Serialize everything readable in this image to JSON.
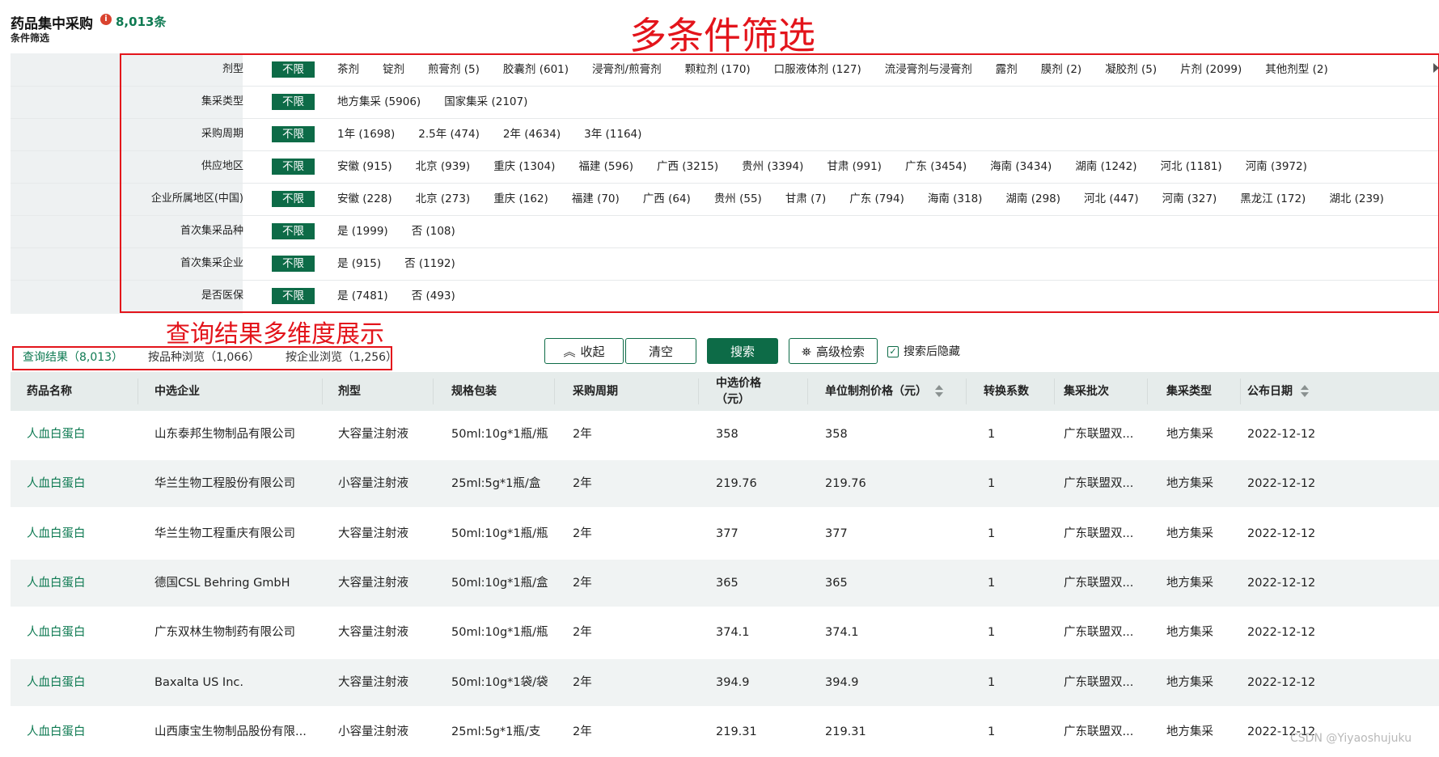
{
  "header": {
    "title": "药品集中采购",
    "info_icon": "info-icon",
    "info_glyph": "i",
    "count": "8,013条",
    "subtitle": "条件筛选"
  },
  "annotations": {
    "filter_note": "多条件筛选",
    "results_note": "查询结果多维度展示"
  },
  "filters": [
    {
      "label": "剂型",
      "options": [
        "不限",
        "茶剂",
        "锭剂",
        "煎膏剂 (5)",
        "胶囊剂 (601)",
        "浸膏剂/煎膏剂",
        "颗粒剂 (170)",
        "口服液体剂 (127)",
        "流浸膏剂与浸膏剂",
        "露剂",
        "膜剂 (2)",
        "凝胶剂 (5)",
        "片剂 (2099)",
        "其他剂型 (2)"
      ]
    },
    {
      "label": "集采类型",
      "options": [
        "不限",
        "地方集采 (5906)",
        "国家集采 (2107)"
      ]
    },
    {
      "label": "采购周期",
      "options": [
        "不限",
        "1年 (1698)",
        "2.5年 (474)",
        "2年 (4634)",
        "3年 (1164)"
      ]
    },
    {
      "label": "供应地区",
      "options": [
        "不限",
        "安徽 (915)",
        "北京 (939)",
        "重庆 (1304)",
        "福建 (596)",
        "广西 (3215)",
        "贵州 (3394)",
        "甘肃 (991)",
        "广东 (3454)",
        "海南 (3434)",
        "湖南 (1242)",
        "河北 (1181)",
        "河南 (3972)"
      ]
    },
    {
      "label": "企业所属地区(中国)",
      "options": [
        "不限",
        "安徽 (228)",
        "北京 (273)",
        "重庆 (162)",
        "福建 (70)",
        "广西 (64)",
        "贵州 (55)",
        "甘肃 (7)",
        "广东 (794)",
        "海南 (318)",
        "湖南 (298)",
        "河北 (447)",
        "河南 (327)",
        "黑龙江 (172)",
        "湖北 (239)"
      ]
    },
    {
      "label": "首次集采品种",
      "options": [
        "不限",
        "是 (1999)",
        "否 (108)"
      ]
    },
    {
      "label": "首次集采企业",
      "options": [
        "不限",
        "是 (915)",
        "否 (1192)"
      ]
    },
    {
      "label": "是否医保",
      "options": [
        "不限",
        "是 (7481)",
        "否 (493)"
      ]
    }
  ],
  "tabs": [
    "查询结果（8,013）",
    "按品种浏览（1,066）",
    "按企业浏览（1,256）"
  ],
  "buttons": {
    "collapse": "收起",
    "collapse_icon": "chevron-up-icon",
    "collapse_glyph": "︽",
    "clear": "清空",
    "search": "搜索",
    "advanced": "高级检索",
    "advanced_icon": "advanced-search-icon",
    "advanced_glyph": "⛯",
    "hide_after_search": "搜索后隐藏",
    "hide_after_search_checked": true,
    "check_glyph": "✓"
  },
  "table": {
    "headers": [
      "药品名称",
      "中选企业",
      "剂型",
      "规格包装",
      "采购周期",
      "中选价格（元）",
      "单位制剂价格（元）",
      "转换系数",
      "集采批次",
      "集采类型",
      "公布日期"
    ],
    "price_header_line1": "中选价格",
    "price_header_line2": "（元）",
    "rows": [
      [
        "人血白蛋白",
        "山东泰邦生物制品有限公司",
        "大容量注射液",
        "50ml:10g*1瓶/瓶",
        "2年",
        "358",
        "358",
        "1",
        "广东联盟双...",
        "地方集采",
        "2022-12-12"
      ],
      [
        "人血白蛋白",
        "华兰生物工程股份有限公司",
        "小容量注射液",
        "25ml:5g*1瓶/盒",
        "2年",
        "219.76",
        "219.76",
        "1",
        "广东联盟双...",
        "地方集采",
        "2022-12-12"
      ],
      [
        "人血白蛋白",
        "华兰生物工程重庆有限公司",
        "大容量注射液",
        "50ml:10g*1瓶/瓶",
        "2年",
        "377",
        "377",
        "1",
        "广东联盟双...",
        "地方集采",
        "2022-12-12"
      ],
      [
        "人血白蛋白",
        "德国CSL Behring GmbH",
        "大容量注射液",
        "50ml:10g*1瓶/盒",
        "2年",
        "365",
        "365",
        "1",
        "广东联盟双...",
        "地方集采",
        "2022-12-12"
      ],
      [
        "人血白蛋白",
        "广东双林生物制药有限公司",
        "大容量注射液",
        "50ml:10g*1瓶/瓶",
        "2年",
        "374.1",
        "374.1",
        "1",
        "广东联盟双...",
        "地方集采",
        "2022-12-12"
      ],
      [
        "人血白蛋白",
        "Baxalta US Inc.",
        "大容量注射液",
        "50ml:10g*1袋/袋",
        "2年",
        "394.9",
        "394.9",
        "1",
        "广东联盟双...",
        "地方集采",
        "2022-12-12"
      ],
      [
        "人血白蛋白",
        "山西康宝生物制品股份有限...",
        "小容量注射液",
        "25ml:5g*1瓶/支",
        "2年",
        "219.31",
        "219.31",
        "1",
        "广东联盟双...",
        "地方集采",
        "2022-12-12"
      ]
    ]
  },
  "watermark": "CSDN @Yiyaoshujuku",
  "colors": {
    "brand": "#0d6b47",
    "link": "#0e7a52",
    "annotation": "#e3141b",
    "header_bg": "#e6eceb",
    "alt_row_bg": "#f0f3f3"
  }
}
